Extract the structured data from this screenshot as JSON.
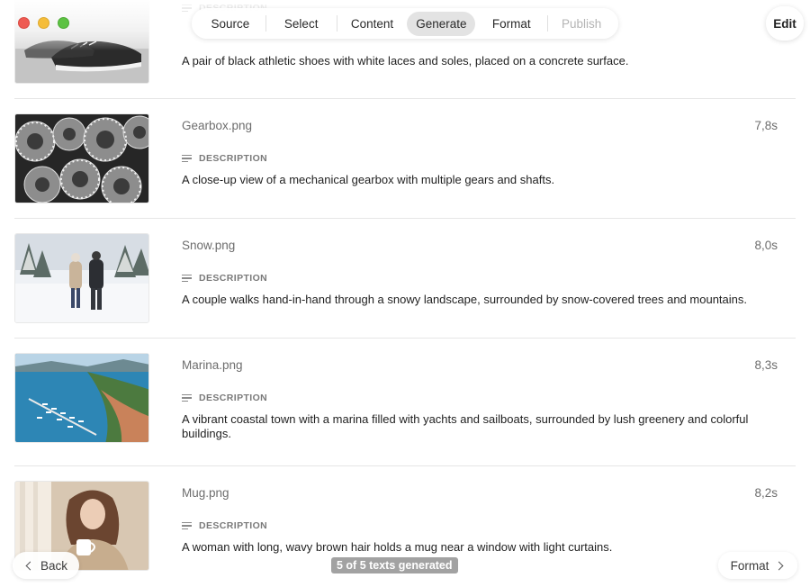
{
  "window": {
    "traffic_lights": [
      "close",
      "minimize",
      "zoom"
    ]
  },
  "nav": {
    "items": [
      {
        "label": "Source",
        "state": "normal"
      },
      {
        "label": "Select",
        "state": "normal"
      },
      {
        "label": "Content",
        "state": "normal"
      },
      {
        "label": "Generate",
        "state": "active"
      },
      {
        "label": "Format",
        "state": "normal"
      },
      {
        "label": "Publish",
        "state": "disabled"
      }
    ],
    "edit_label": "Edit"
  },
  "items": [
    {
      "filename": "",
      "duration": "",
      "description_label": "DESCRIPTION",
      "description": "A pair of black athletic shoes with white laces and soles, placed on a concrete surface.",
      "thumbnail": "shoes-image"
    },
    {
      "filename": "Gearbox.png",
      "duration": "7,8s",
      "description_label": "DESCRIPTION",
      "description": "A close-up view of a mechanical gearbox with multiple gears and shafts.",
      "thumbnail": "gearbox-image"
    },
    {
      "filename": "Snow.png",
      "duration": "8,0s",
      "description_label": "DESCRIPTION",
      "description": "A couple walks hand-in-hand through a snowy landscape, surrounded by snow-covered trees and mountains.",
      "thumbnail": "snow-image"
    },
    {
      "filename": "Marina.png",
      "duration": "8,3s",
      "description_label": "DESCRIPTION",
      "description": "A vibrant coastal town with a marina filled with yachts and sailboats, surrounded by lush greenery and colorful buildings.",
      "thumbnail": "marina-image"
    },
    {
      "filename": "Mug.png",
      "duration": "8,2s",
      "description_label": "DESCRIPTION",
      "description": "A woman with long, wavy brown hair holds a mug near a window with light curtains.",
      "thumbnail": "mug-image"
    }
  ],
  "footer": {
    "back_label": "Back",
    "status": "5 of 5 texts generated",
    "next_label": "Format"
  }
}
